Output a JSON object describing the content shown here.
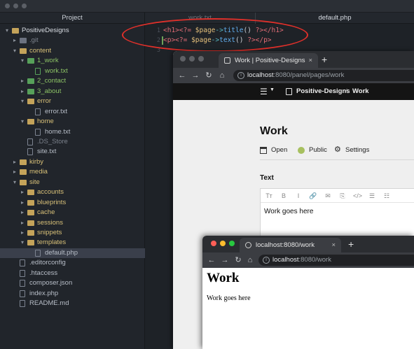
{
  "editor": {
    "tabs": {
      "project": "Project",
      "file1": "work.txt",
      "file2": "default.php"
    },
    "sidebar": {
      "items": [
        {
          "label": "PositiveDesigns",
          "depth": 0,
          "kind": "root",
          "open": true
        },
        {
          "label": ".git",
          "depth": 1,
          "kind": "folder-gray",
          "open": false
        },
        {
          "label": "content",
          "depth": 1,
          "kind": "folder",
          "open": true
        },
        {
          "label": "1_work",
          "depth": 2,
          "kind": "folder-green",
          "open": true
        },
        {
          "label": "work.txt",
          "depth": 3,
          "kind": "file-green"
        },
        {
          "label": "2_contact",
          "depth": 2,
          "kind": "folder-green",
          "open": false
        },
        {
          "label": "3_about",
          "depth": 2,
          "kind": "folder-green",
          "open": false
        },
        {
          "label": "error",
          "depth": 2,
          "kind": "folder",
          "open": true
        },
        {
          "label": "error.txt",
          "depth": 3,
          "kind": "file"
        },
        {
          "label": "home",
          "depth": 2,
          "kind": "folder",
          "open": true
        },
        {
          "label": "home.txt",
          "depth": 3,
          "kind": "file"
        },
        {
          "label": ".DS_Store",
          "depth": 2,
          "kind": "file-gray"
        },
        {
          "label": "site.txt",
          "depth": 2,
          "kind": "file"
        },
        {
          "label": "kirby",
          "depth": 1,
          "kind": "folder",
          "open": false
        },
        {
          "label": "media",
          "depth": 1,
          "kind": "folder",
          "open": false
        },
        {
          "label": "site",
          "depth": 1,
          "kind": "folder",
          "open": true
        },
        {
          "label": "accounts",
          "depth": 2,
          "kind": "folder",
          "open": false
        },
        {
          "label": "blueprints",
          "depth": 2,
          "kind": "folder",
          "open": false
        },
        {
          "label": "cache",
          "depth": 2,
          "kind": "folder",
          "open": false
        },
        {
          "label": "sessions",
          "depth": 2,
          "kind": "folder",
          "open": false
        },
        {
          "label": "snippets",
          "depth": 2,
          "kind": "folder",
          "open": false
        },
        {
          "label": "templates",
          "depth": 2,
          "kind": "folder",
          "open": true
        },
        {
          "label": "default.php",
          "depth": 3,
          "kind": "file",
          "selected": true
        },
        {
          "label": ".editorconfig",
          "depth": 1,
          "kind": "file"
        },
        {
          "label": ".htaccess",
          "depth": 1,
          "kind": "file"
        },
        {
          "label": "composer.json",
          "depth": 1,
          "kind": "file"
        },
        {
          "label": "index.php",
          "depth": 1,
          "kind": "file"
        },
        {
          "label": "README.md",
          "depth": 1,
          "kind": "file"
        }
      ]
    },
    "code": {
      "line_numbers": [
        "1",
        "2",
        "3"
      ],
      "line1": {
        "t1": "<h1>",
        "t2": "<?=",
        "t3": " $page",
        "t4": "->",
        "t5": "title",
        "t6": "() ",
        "t7": "?>",
        "t8": "</h1>"
      },
      "line2": {
        "t1": "<p>",
        "t2": "<?=",
        "t3": " $page",
        "t4": "->",
        "t5": "text",
        "t6": "() ",
        "t7": "?>",
        "t8": "</p>"
      }
    }
  },
  "browser_panel": {
    "tab_title": "Work | Positive-Designs",
    "tab_close": "×",
    "new_tab": "+",
    "url_host": "localhost",
    "url_path": ":8080/panel/pages/work",
    "topbar": {
      "menu_icon": "☰",
      "site_name": "Positive-Designs",
      "separator": "/",
      "crumb": "Work"
    },
    "page_title": "Work",
    "options": {
      "open": "Open",
      "status": "Public",
      "settings": "Settings"
    },
    "status_color": "#a7c05f",
    "field_label": "Text",
    "field_value": "Work goes here",
    "toolbar_icons": [
      "Tт",
      "B",
      "I",
      "🔗",
      "✉",
      "⎘",
      "</>",
      "☰",
      "☷"
    ]
  },
  "browser_site": {
    "tab_title": "localhost:8080/work",
    "tab_close": "×",
    "new_tab": "+",
    "url_host": "localhost",
    "url_path": ":8080/work",
    "heading": "Work",
    "paragraph": "Work goes here",
    "traffic_lights": [
      "#ff5f57",
      "#febc2e",
      "#28c840"
    ]
  }
}
